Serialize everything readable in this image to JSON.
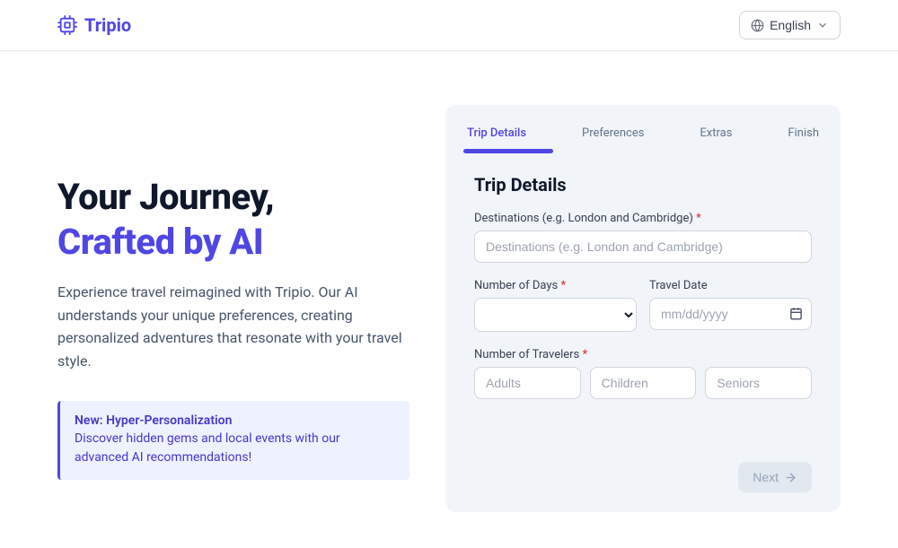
{
  "header": {
    "brand": "Tripio",
    "lang_label": "English"
  },
  "hero": {
    "line1": "Your Journey,",
    "line2": "Crafted by AI",
    "sub": "Experience travel reimagined with Tripio. Our AI understands your unique preferences, creating personalized adventures that resonate with your travel style.",
    "callout_title": "New: Hyper-Personalization",
    "callout_body": "Discover hidden gems and local events with our advanced AI recommendations!"
  },
  "wizard": {
    "tabs": {
      "t1": "Trip Details",
      "t2": "Preferences",
      "t3": "Extras",
      "t4": "Finish"
    },
    "section_title": "Trip Details",
    "labels": {
      "destinations": "Destinations (e.g. London and Cambridge)",
      "days": "Number of Days",
      "date": "Travel Date",
      "travelers": "Number of Travelers"
    },
    "placeholders": {
      "destinations": "Destinations (e.g. London and Cambridge)",
      "date": "mm/dd/yyyy",
      "adults": "Adults",
      "children": "Children",
      "seniors": "Seniors"
    },
    "next_label": "Next"
  }
}
